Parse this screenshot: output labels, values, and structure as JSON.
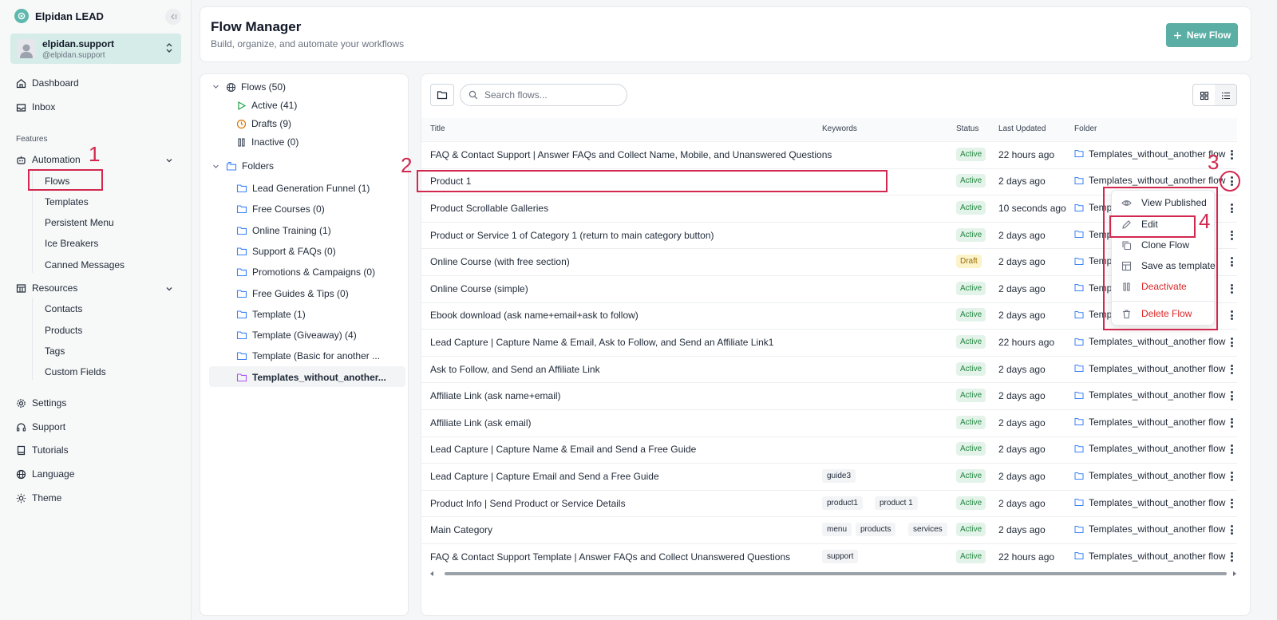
{
  "app": {
    "name": "Elpidan LEAD"
  },
  "user": {
    "name": "elpidan.support",
    "handle": "@elpidan.support"
  },
  "nav": {
    "dashboard": "Dashboard",
    "inbox": "Inbox",
    "features_section": "Features",
    "automation": "Automation",
    "automation_items": [
      "Flows",
      "Templates",
      "Persistent Menu",
      "Ice Breakers",
      "Canned Messages"
    ],
    "resources": "Resources",
    "resources_items": [
      "Contacts",
      "Products",
      "Tags",
      "Custom Fields"
    ],
    "settings": "Settings",
    "support": "Support",
    "tutorials": "Tutorials",
    "language": "Language",
    "theme": "Theme"
  },
  "header": {
    "title": "Flow Manager",
    "subtitle": "Build, organize, and automate your workflows",
    "new_flow_label": "New Flow"
  },
  "tree": {
    "flows_label": "Flows (50)",
    "active_label": "Active (41)",
    "drafts_label": "Drafts (9)",
    "inactive_label": "Inactive (0)",
    "folders_label": "Folders",
    "folders": [
      "Lead Generation Funnel (1)",
      "Free Courses (0)",
      "Online Training (1)",
      "Support & FAQs (0)",
      "Promotions & Campaigns (0)",
      "Free Guides & Tips (0)",
      "Template (1)",
      "Template (Giveaway) (4)",
      "Template (Basic for another ...",
      "Templates_without_another..."
    ]
  },
  "search": {
    "placeholder": "Search flows..."
  },
  "table": {
    "columns": {
      "title": "Title",
      "keywords": "Keywords",
      "status": "Status",
      "updated": "Last Updated",
      "folder": "Folder"
    },
    "rows": [
      {
        "title": "FAQ & Contact Support | Answer FAQs and Collect Name, Mobile, and Unanswered Questions",
        "keywords": [],
        "status": "Active",
        "updated": "22 hours ago",
        "folder": "Templates_without_another flow"
      },
      {
        "title": "Product 1",
        "keywords": [],
        "status": "Active",
        "updated": "2 days ago",
        "folder": "Templates_without_another flow"
      },
      {
        "title": "Product Scrollable Galleries",
        "keywords": [],
        "status": "Active",
        "updated": "10 seconds ago",
        "folder": "Templ"
      },
      {
        "title": "Product or Service 1 of Category 1 (return to main category button)",
        "keywords": [],
        "status": "Active",
        "updated": "2 days ago",
        "folder": "Templ"
      },
      {
        "title": "Online Course (with free section)",
        "keywords": [],
        "status": "Draft",
        "updated": "2 days ago",
        "folder": "Templ"
      },
      {
        "title": "Online Course (simple)",
        "keywords": [],
        "status": "Active",
        "updated": "2 days ago",
        "folder": "Templ"
      },
      {
        "title": "Ebook download (ask name+email+ask to follow)",
        "keywords": [],
        "status": "Active",
        "updated": "2 days ago",
        "folder": "Templ"
      },
      {
        "title": "Lead Capture | Capture Name & Email, Ask to Follow, and Send an Affiliate Link1",
        "keywords": [],
        "status": "Active",
        "updated": "22 hours ago",
        "folder": "Templates_without_another flow"
      },
      {
        "title": "Ask to Follow, and Send an Affiliate Link",
        "keywords": [],
        "status": "Active",
        "updated": "2 days ago",
        "folder": "Templates_without_another flow"
      },
      {
        "title": "Affiliate Link (ask name+email)",
        "keywords": [],
        "status": "Active",
        "updated": "2 days ago",
        "folder": "Templates_without_another flow"
      },
      {
        "title": "Affiliate Link (ask email)",
        "keywords": [],
        "status": "Active",
        "updated": "2 days ago",
        "folder": "Templates_without_another flow"
      },
      {
        "title": "Lead Capture | Capture Name & Email and Send a Free Guide",
        "keywords": [],
        "status": "Active",
        "updated": "2 days ago",
        "folder": "Templates_without_another flow"
      },
      {
        "title": "Lead Capture | Capture Email and Send a Free Guide",
        "keywords": [
          "guide3"
        ],
        "status": "Active",
        "updated": "2 days ago",
        "folder": "Templates_without_another flow"
      },
      {
        "title": "Product Info | Send Product or Service Details",
        "keywords": [
          "product1",
          "product 1"
        ],
        "status": "Active",
        "updated": "2 days ago",
        "folder": "Templates_without_another flow"
      },
      {
        "title": "Main Category",
        "keywords": [
          "menu",
          "products",
          "services"
        ],
        "status": "Active",
        "updated": "2 days ago",
        "folder": "Templates_without_another flow"
      },
      {
        "title": "FAQ & Contact Support Template | Answer FAQs and Collect Unanswered Questions",
        "keywords": [
          "support"
        ],
        "status": "Active",
        "updated": "22 hours ago",
        "folder": "Templates_without_another flow"
      }
    ]
  },
  "menu": {
    "view_published": "View Published",
    "edit": "Edit",
    "clone": "Clone Flow",
    "save_template": "Save as template",
    "deactivate": "Deactivate",
    "delete": "Delete Flow"
  },
  "markers": [
    "1",
    "2",
    "3",
    "4"
  ],
  "colors": {
    "accent": "#5aaea4",
    "annotation": "#d2284f",
    "danger": "#dc2626",
    "active_badge": "#22873f"
  }
}
